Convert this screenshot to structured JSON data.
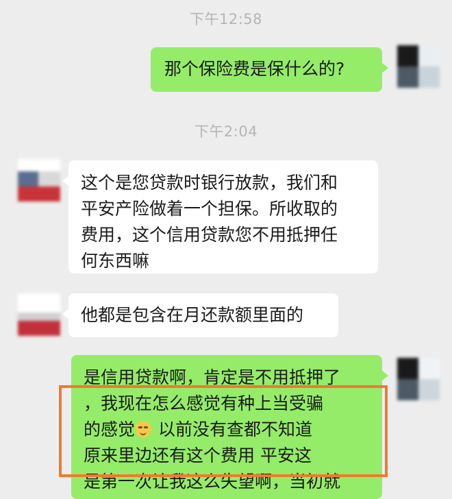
{
  "chat": {
    "timestamps": [
      "下午12:58",
      "下午2:04"
    ],
    "messages": [
      {
        "side": "right",
        "lines": [
          "那个保险费是保什么的?"
        ]
      },
      {
        "side": "left",
        "lines": [
          "这个是您贷款时银行放款，我们和",
          "平安产险做着一个担保。所收取的",
          "费用，这个信用贷款您不用抵押任",
          "何东西嘛"
        ]
      },
      {
        "side": "left",
        "lines": [
          "他都是包含在月还款额里面的"
        ]
      },
      {
        "side": "right",
        "lines": [
          "是信用贷款啊，肯定是不用抵押了",
          "，我现在怎么感觉有种上当受骗",
          "的感觉",
          " 以前没有查都不知道",
          "原来里边还有这个费用     平安这",
          "是第一次让我这么失望啊，当初就"
        ]
      }
    ],
    "emoji": "smirk-emoji",
    "colors": {
      "background": "#ededed",
      "self_bubble": "#95ec69",
      "other_bubble": "#ffffff",
      "timestamp": "#b5b5b5",
      "highlight_border": "#f07a2c"
    }
  }
}
